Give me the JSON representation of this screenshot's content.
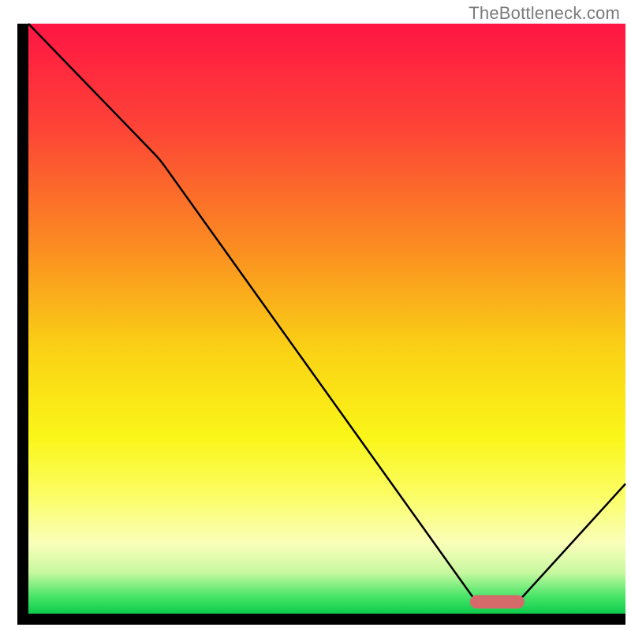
{
  "attribution": "TheBottleneck.com",
  "chart_data": {
    "type": "line",
    "title": "",
    "xlabel": "",
    "ylabel": "",
    "xlim": [
      0,
      100
    ],
    "ylim": [
      0,
      100
    ],
    "series": [
      {
        "name": "bottleneck-curve",
        "x": [
          0,
          22,
          75,
          82,
          100
        ],
        "y": [
          100,
          77,
          2,
          2,
          22
        ]
      }
    ],
    "marker": {
      "name": "optimal-band",
      "x_start": 75,
      "x_end": 82,
      "y": 2,
      "color": "#d66a6a"
    },
    "background_gradient": {
      "stops": [
        {
          "t": 0.0,
          "color": "#fe1544"
        },
        {
          "t": 0.18,
          "color": "#fd4536"
        },
        {
          "t": 0.38,
          "color": "#fb8d21"
        },
        {
          "t": 0.55,
          "color": "#fad115"
        },
        {
          "t": 0.7,
          "color": "#faf618"
        },
        {
          "t": 0.8,
          "color": "#fbfd65"
        },
        {
          "t": 0.88,
          "color": "#faffb9"
        },
        {
          "t": 0.93,
          "color": "#c8f8a0"
        },
        {
          "t": 0.97,
          "color": "#4be669"
        },
        {
          "t": 1.0,
          "color": "#0ccb4a"
        }
      ]
    },
    "axes_color": "#000000",
    "axes_width": 14,
    "line_color": "#000000",
    "line_width": 2.5
  }
}
